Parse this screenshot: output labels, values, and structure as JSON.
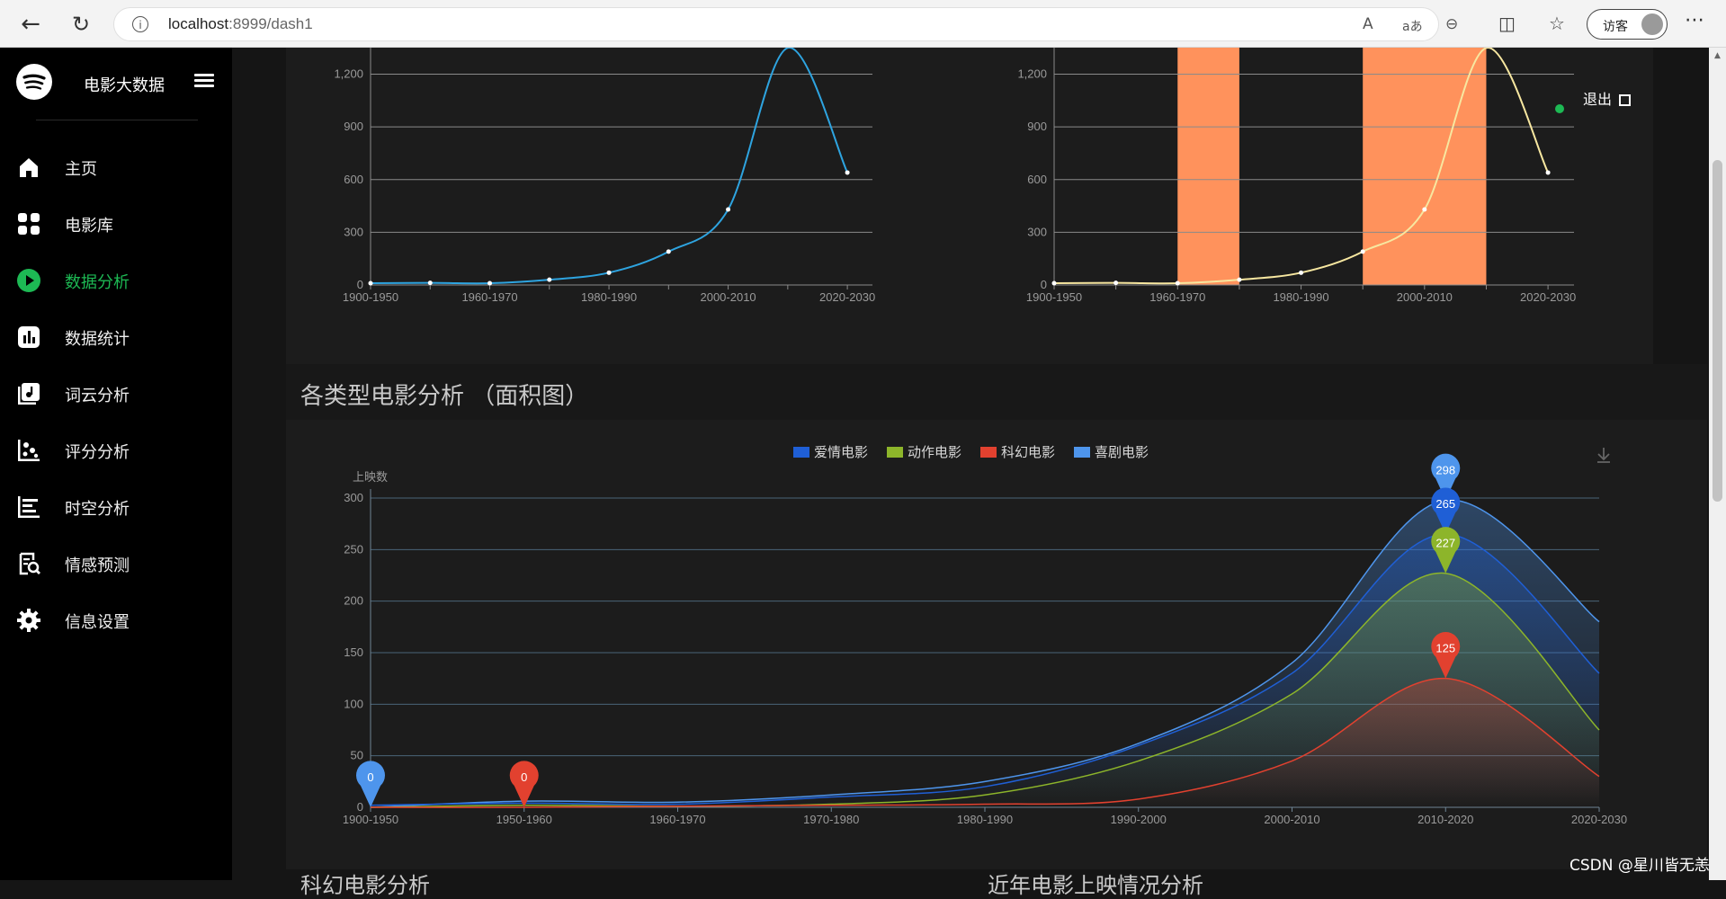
{
  "browser": {
    "url_host": "localhost",
    "url_path": ":8999/dash1",
    "guest_label": "访客",
    "more_label": "⋯"
  },
  "sidebar": {
    "brand": "电影大数据",
    "items": [
      {
        "label": "主页",
        "icon": "home-icon",
        "active": false
      },
      {
        "label": "电影库",
        "icon": "grid-icon",
        "active": false
      },
      {
        "label": "数据分析",
        "icon": "play-icon",
        "active": true
      },
      {
        "label": "数据统计",
        "icon": "bar-chart-icon",
        "active": false
      },
      {
        "label": "词云分析",
        "icon": "music-note-icon",
        "active": false
      },
      {
        "label": "评分分析",
        "icon": "scatter-icon",
        "active": false
      },
      {
        "label": "时空分析",
        "icon": "timeline-icon",
        "active": false
      },
      {
        "label": "情感预测",
        "icon": "search-doc-icon",
        "active": false
      },
      {
        "label": "信息设置",
        "icon": "gear-icon",
        "active": false
      }
    ]
  },
  "header": {
    "logout": "退出"
  },
  "sections": {
    "area_title": "各类型电影分析 （面积图）",
    "bottom_left_title": "科幻电影分析",
    "bottom_right_title": "近年电影上映情况分析"
  },
  "watermark": "CSDN @星川皆无恙",
  "colors": {
    "accent_green": "#1db954",
    "line_blue": "#2ea4e0",
    "line_yellow": "#f7e7a0",
    "band_orange": "#ff925c",
    "romance": "#1f5fd6",
    "action": "#8db52a",
    "scifi": "#e2412f",
    "comedy": "#4e95ec"
  },
  "chart_data": [
    {
      "type": "line",
      "x": [
        "1900-1950",
        "1950-1960",
        "1960-1970",
        "1970-1980",
        "1980-1990",
        "1990-2000",
        "2000-2010",
        "2010-2020",
        "2020-2030"
      ],
      "x_tick_labels": [
        "1900-1950",
        "1960-1970",
        "1980-1990",
        "2000-2010",
        "2020-2030"
      ],
      "series": [
        {
          "values": [
            10,
            12,
            10,
            30,
            70,
            190,
            430,
            1350,
            640
          ]
        }
      ],
      "ylim": [
        0,
        1300
      ],
      "y_ticks": [
        0,
        300,
        600,
        900,
        1200
      ],
      "grid": true
    },
    {
      "type": "line",
      "x": [
        "1900-1950",
        "1950-1960",
        "1960-1970",
        "1970-1980",
        "1980-1990",
        "1990-2000",
        "2000-2010",
        "2010-2020",
        "2020-2030"
      ],
      "x_tick_labels": [
        "1900-1950",
        "1960-1970",
        "1980-1990",
        "2000-2010",
        "2020-2030"
      ],
      "series": [
        {
          "values": [
            10,
            12,
            10,
            30,
            70,
            190,
            430,
            1350,
            640
          ]
        }
      ],
      "highlight_bands": [
        [
          "1960-1970",
          "1970-1980"
        ],
        [
          "1990-2000",
          "2010-2020"
        ]
      ],
      "ylim": [
        0,
        1300
      ],
      "y_ticks": [
        0,
        300,
        600,
        900,
        1200
      ],
      "grid": true
    },
    {
      "type": "area",
      "categories": [
        "1900-1950",
        "1950-1960",
        "1960-1970",
        "1970-1980",
        "1980-1990",
        "1990-2000",
        "2000-2010",
        "2010-2020",
        "2020-2030"
      ],
      "ylabel": "上映数",
      "ylim": [
        0,
        300
      ],
      "y_ticks": [
        0,
        50,
        100,
        150,
        200,
        250,
        300
      ],
      "legend_position": "top-center",
      "series": [
        {
          "name": "爱情电影",
          "color": "#1f5fd6",
          "values": [
            2,
            4,
            3,
            10,
            20,
            60,
            130,
            265,
            130
          ]
        },
        {
          "name": "动作电影",
          "color": "#8db52a",
          "values": [
            0,
            2,
            1,
            3,
            12,
            45,
            110,
            227,
            75
          ]
        },
        {
          "name": "科幻电影",
          "color": "#e2412f",
          "values": [
            0,
            0,
            1,
            2,
            3,
            8,
            45,
            125,
            30
          ]
        },
        {
          "name": "喜剧电影",
          "color": "#4e95ec",
          "values": [
            0,
            6,
            5,
            12,
            25,
            62,
            140,
            298,
            180
          ]
        }
      ],
      "markers": [
        {
          "x": "1900-1950",
          "label": "0",
          "color": "#4e95ec",
          "value": 0
        },
        {
          "x": "1950-1960",
          "label": "0",
          "color": "#e2412f",
          "value": 0
        },
        {
          "x": "2010-2020",
          "label": "298",
          "color": "#4e95ec",
          "value": 298
        },
        {
          "x": "2010-2020",
          "label": "265",
          "color": "#1f5fd6",
          "value": 265
        },
        {
          "x": "2010-2020",
          "label": "227",
          "color": "#8db52a",
          "value": 227
        },
        {
          "x": "2010-2020",
          "label": "125",
          "color": "#e2412f",
          "value": 125
        }
      ],
      "grid": true
    }
  ]
}
